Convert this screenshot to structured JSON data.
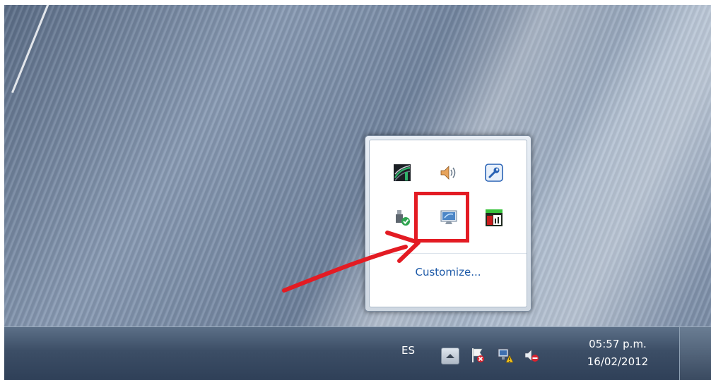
{
  "overflow_popup": {
    "customize_label": "Customize...",
    "icons": [
      {
        "name": "wireless-signal-icon"
      },
      {
        "name": "volume-icon"
      },
      {
        "name": "wrench-settings-icon"
      },
      {
        "name": "safely-remove-usb-icon"
      },
      {
        "name": "display-settings-icon",
        "highlighted": true
      },
      {
        "name": "monitor-chart-icon"
      }
    ]
  },
  "taskbar": {
    "language": "ES",
    "show_hidden_icons_icon": "up-arrow-icon",
    "tray_icons": [
      "action-center-flag-icon",
      "network-warning-icon",
      "volume-muted-icon"
    ],
    "clock_time": "05:57 p.m.",
    "clock_date": "16/02/2012"
  },
  "annotation": {
    "color": "#e31b23"
  }
}
